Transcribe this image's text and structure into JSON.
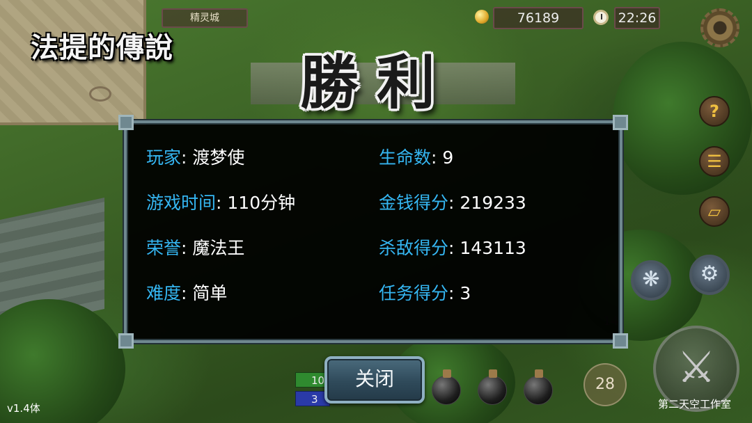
{
  "hud": {
    "location": "精灵城",
    "gold": "76189",
    "time": "22:26"
  },
  "game_title": "法提的傳說",
  "victory_title": "勝利",
  "results": [
    {
      "label": "玩家",
      "value": "渡梦使"
    },
    {
      "label": "游戏时间",
      "value": "110分钟"
    },
    {
      "label": "荣誉",
      "value": "魔法王"
    },
    {
      "label": "难度",
      "value": "简单"
    },
    {
      "label": "生命数",
      "value": "9"
    },
    {
      "label": "金钱得分",
      "value": "219233"
    },
    {
      "label": "杀敌得分",
      "value": "143113"
    },
    {
      "label": "任务得分",
      "value": "3"
    }
  ],
  "colors": {
    "label": "#35b6f2",
    "value": "#ffffff",
    "panel_border": "#6f8890"
  },
  "close_button": "关闭",
  "bottom": {
    "hp": "10",
    "mp": "3",
    "skill_count": "28",
    "map_marker": "14",
    "version": "v1.4体",
    "studio": "第二天空工作室"
  },
  "icons": {
    "settings": "gear-icon",
    "help": "help-question-icon",
    "scroll": "scroll-icon",
    "bag": "bag-icon",
    "skill1": "whirlwind-skill-icon",
    "skill2": "blade-skill-icon",
    "attack": "sword-icon",
    "potion": "potion-icon",
    "gold": "coin-icon",
    "clock": "clock-icon"
  }
}
